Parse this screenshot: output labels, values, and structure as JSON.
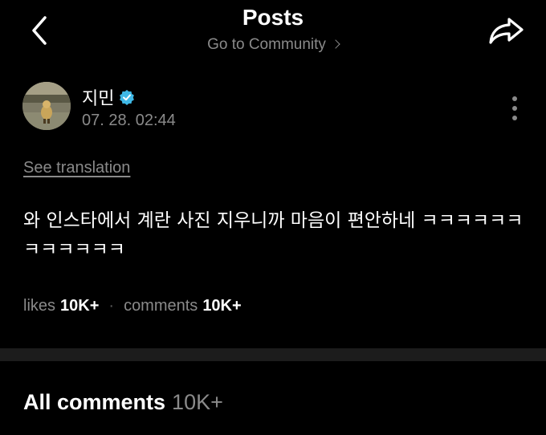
{
  "header": {
    "title": "Posts",
    "subtitle": "Go to Community",
    "back_icon": "chevron-left-icon",
    "share_icon": "share-arrow-icon"
  },
  "post": {
    "author": "지민",
    "verified_icon": "verified-check-icon",
    "verified_color": "#3fb8e6",
    "timestamp": "07. 28. 02:44",
    "translate_link": "See translation",
    "body": "와 인스타에서 계란 사진 지우니까 마음이 편안하네 ㅋㅋㅋㅋㅋㅋㅋㅋㅋㅋㅋㅋ",
    "likes_label": "likes",
    "likes_count": "10K+",
    "comments_label": "comments",
    "comments_count": "10K+"
  },
  "comments_section": {
    "title": "All comments",
    "count": "10K+"
  },
  "colors": {
    "background": "#000000",
    "primary_text": "#ffffff",
    "secondary_text": "#8a8a8a",
    "divider": "#1c1c1c"
  }
}
